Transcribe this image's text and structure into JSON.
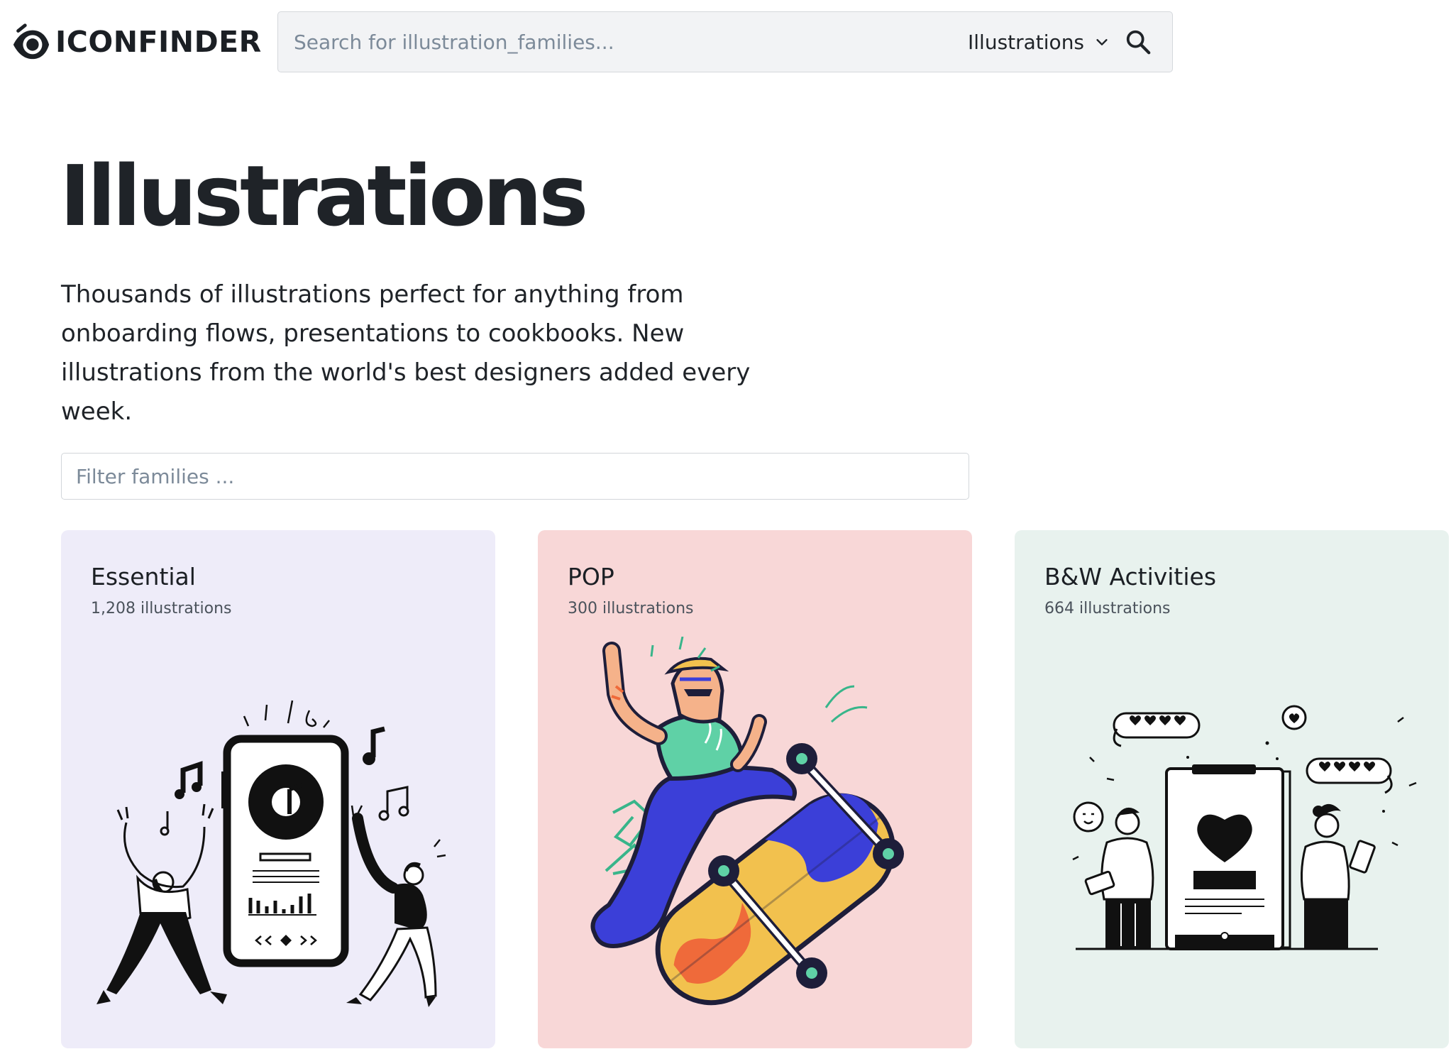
{
  "brand": {
    "name": "ICONFINDER"
  },
  "search": {
    "placeholder": "Search for illustration_families...",
    "value": "",
    "type_selected": "Illustrations"
  },
  "hero": {
    "title": "Illustrations",
    "description": "Thousands of illustrations perfect for anything from onboarding flows, presentations to cookbooks. New illustrations from the world's best designers added every week."
  },
  "filter": {
    "placeholder": "Filter families ...",
    "value": ""
  },
  "families": [
    {
      "title": "Essential",
      "count": "1,208 illustrations",
      "bg": "#eeecf9"
    },
    {
      "title": "POP",
      "count": "300 illustrations",
      "bg": "#f8d7d7"
    },
    {
      "title": "B&W Activities",
      "count": "664 illustrations",
      "bg": "#e8f2ee"
    }
  ],
  "colors": {
    "text": "#1f2328",
    "muted": "#7c8a99",
    "pop_blue": "#3b3fd8",
    "pop_yellow": "#f2c14e",
    "pop_orange": "#ef6a3a",
    "pop_green": "#5fd1a6"
  }
}
